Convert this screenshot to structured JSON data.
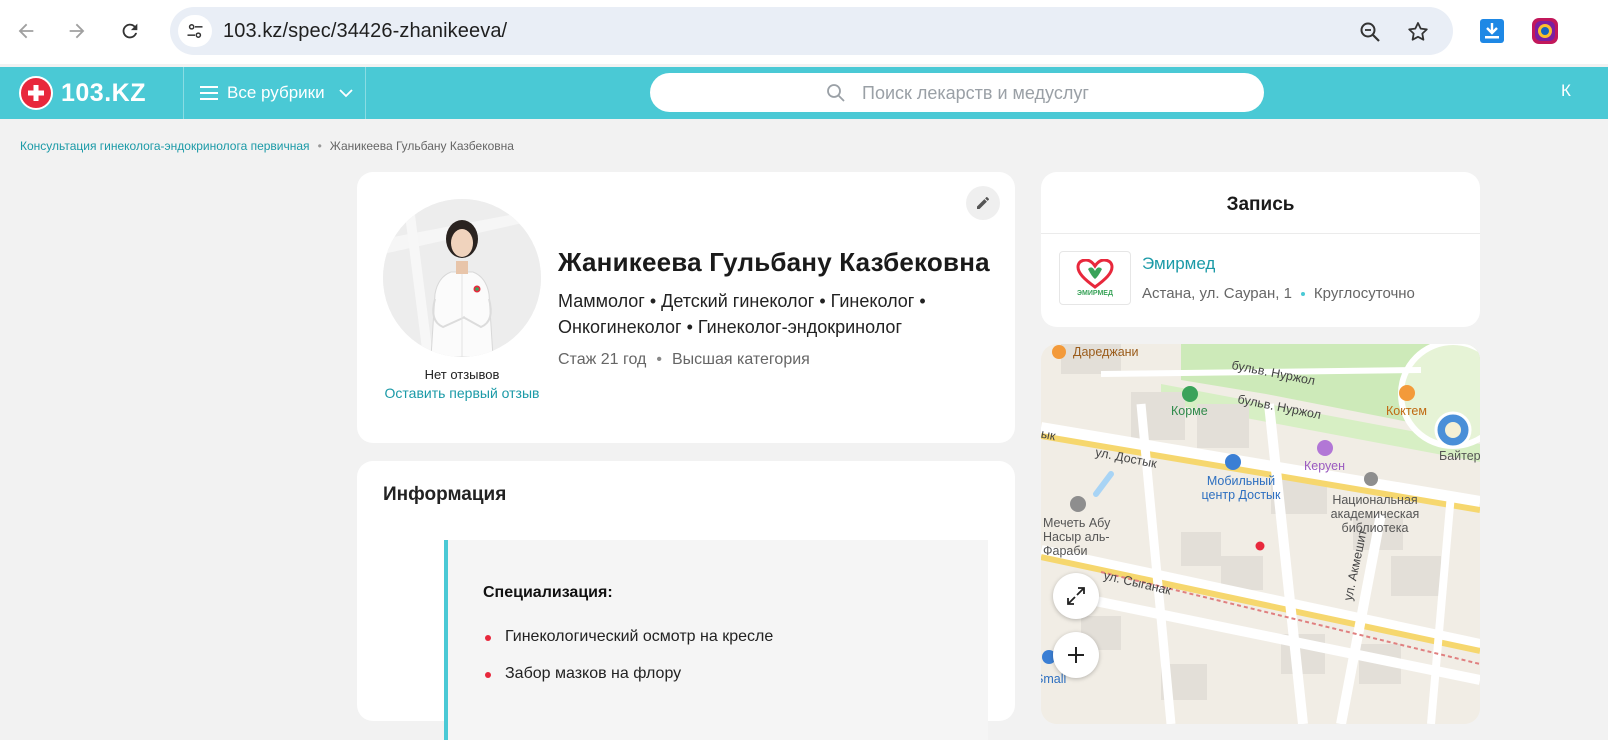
{
  "browser": {
    "url": "103.kz/spec/34426-zhanikeeva/"
  },
  "header": {
    "logo_text": "103.KZ",
    "rubrics_label": "Все рубрики",
    "search_placeholder": "Поиск лекарств и медуслуг",
    "cut_text": "К"
  },
  "breadcrumb": {
    "parent": "Консультация гинеколога-эндокринолога первичная",
    "separator": "•",
    "current": "Жаникеева Гульбану Казбековна"
  },
  "profile": {
    "name": "Жаникеева Гульбану Казбековна",
    "specialties": "Маммолог • Детский гинеколог • Гинеколог • Онкогинеколог • Гинеколог-эндокринолог",
    "experience": "Стаж 21 год",
    "meta_separator": "•",
    "category": "Высшая категория",
    "no_reviews": "Нет отзывов",
    "first_review_link": "Оставить первый отзыв"
  },
  "info": {
    "title": "Информация",
    "subtitle": "Специализация:",
    "items": [
      "Гинекологический осмотр на кресле",
      "Забор мазков на флору"
    ]
  },
  "booking": {
    "title": "Запись",
    "clinic_name": "Эмирмед",
    "clinic_logo_text": "ЭМИРМЕД",
    "address": "Астана, ул. Сауран, 1",
    "hours": "Круглосуточно"
  },
  "map": {
    "labels": {
      "daredzhani": "Дареджани",
      "nurzhol1": "бульв. Нуржол",
      "nurzhol2": "бульв. Нуржол",
      "korme": "Корме",
      "koktem": "Коктем",
      "baiterek": "Байтерек",
      "dostyk_cut": "ык",
      "dostyk": "ул. Достык",
      "keruen": "Керуен",
      "mobile_center": "Мобильный центр Достык",
      "library": "Национальная академическая библиотека",
      "mosque": "Мечеть Абу Насыр аль-Фараби",
      "syganak": "ул. Сыганак",
      "akmeshit": "ул. Акмешит",
      "cut_bottom": "Small"
    }
  },
  "colors": {
    "brand_teal": "#4ac9d5",
    "link_teal": "#1b9aa7",
    "accent_red": "#e8283c"
  }
}
